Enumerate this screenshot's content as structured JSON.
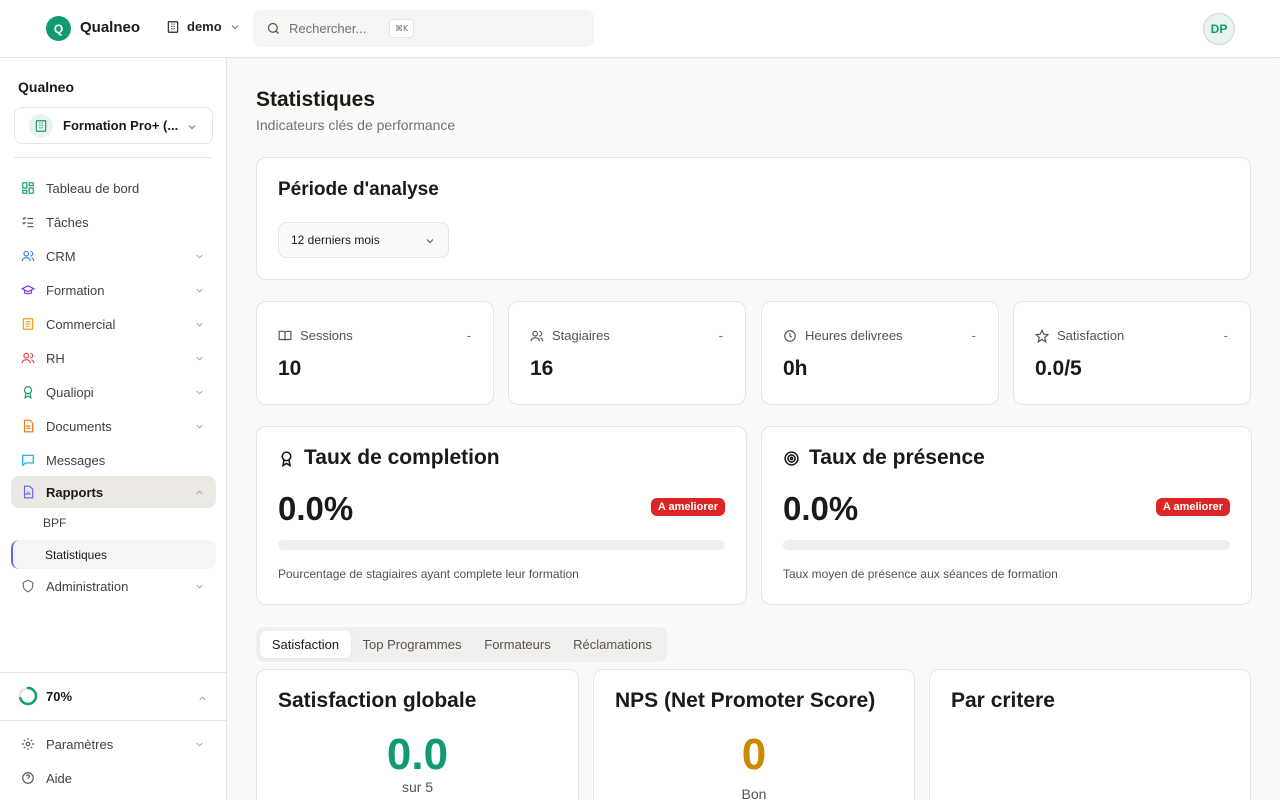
{
  "app": {
    "logo_letter": "Q",
    "name": "Qualneo"
  },
  "workspace": {
    "label": "demo"
  },
  "search": {
    "placeholder": "Rechercher...",
    "shortcut": "⌘K"
  },
  "user": {
    "initials": "DP"
  },
  "sidebar": {
    "org_name": "Qualneo",
    "org_select": "Formation Pro+ (...",
    "items": [
      {
        "label": "Tableau de bord",
        "icon": "dashboard-icon",
        "color": "#129b72"
      },
      {
        "label": "Tâches",
        "icon": "tasks-icon",
        "color": "#57534e"
      },
      {
        "label": "CRM",
        "icon": "users-icon",
        "color": "#3b82f6"
      },
      {
        "label": "Formation",
        "icon": "graduation-cap-icon",
        "color": "#7c3aed"
      },
      {
        "label": "Commercial",
        "icon": "receipt-icon",
        "color": "#f59e0b"
      },
      {
        "label": "RH",
        "icon": "people-icon",
        "color": "#ef4444"
      },
      {
        "label": "Qualiopi",
        "icon": "award-icon",
        "color": "#129b72"
      },
      {
        "label": "Documents",
        "icon": "document-icon",
        "color": "#f97316"
      },
      {
        "label": "Messages",
        "icon": "message-icon",
        "color": "#0ea5e9"
      },
      {
        "label": "Rapports",
        "icon": "report-icon",
        "color": "#6366f1"
      }
    ],
    "rapports_sub": [
      "BPF",
      "Statistiques"
    ],
    "admin": "Administration",
    "progress": "70%",
    "progress_value": 0.7,
    "footer": [
      "Paramètres",
      "Aide"
    ]
  },
  "page": {
    "title": "Statistiques",
    "subtitle": "Indicateurs clés de performance"
  },
  "period": {
    "title": "Période d'analyse",
    "value": "12 derniers mois"
  },
  "stats": [
    {
      "label": "Sessions",
      "value": "10",
      "trend": "-",
      "icon": "book-icon"
    },
    {
      "label": "Stagiaires",
      "value": "16",
      "trend": "-",
      "icon": "users-icon"
    },
    {
      "label": "Heures delivrees",
      "value": "0h",
      "trend": "-",
      "icon": "clock-icon"
    },
    {
      "label": "Satisfaction",
      "value": "0.0/5",
      "trend": "-",
      "icon": "star-icon"
    }
  ],
  "completion": {
    "title": "Taux de completion",
    "value": "0.0%",
    "fill": 0.0,
    "badge": "A ameliorer",
    "description": "Pourcentage de stagiaires ayant complete leur formation"
  },
  "presence": {
    "title": "Taux de présence",
    "value": "0.0%",
    "fill": 0.0,
    "badge": "A ameliorer",
    "description": "Taux moyen de présence aux séances de formation"
  },
  "tabs": [
    "Satisfaction",
    "Top Programmes",
    "Formateurs",
    "Réclamations"
  ],
  "satisfaction_global": {
    "title": "Satisfaction globale",
    "value": "0.0",
    "sub": "sur 5",
    "color": "#129b72"
  },
  "nps": {
    "title": "NPS (Net Promoter Score)",
    "value": "0",
    "sub": "Bon",
    "color": "#ca8a04"
  },
  "criteria": {
    "title": "Par critere"
  }
}
